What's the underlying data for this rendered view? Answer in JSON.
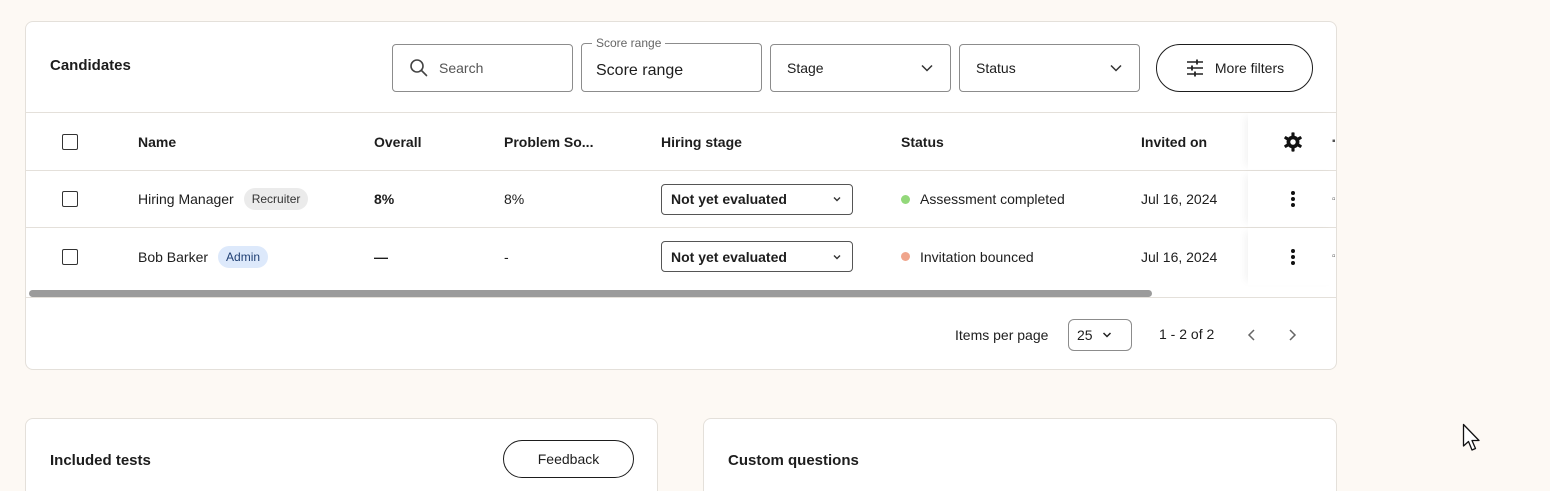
{
  "toolbar": {
    "title": "Candidates",
    "search_placeholder": "Search",
    "score_range_label": "Score range",
    "score_range_value": "Score range",
    "stage_label": "Stage",
    "status_label": "Status",
    "more_filters_label": "More filters"
  },
  "table": {
    "headers": {
      "name": "Name",
      "overall": "Overall",
      "problem": "Problem So...",
      "hiring_stage": "Hiring stage",
      "status": "Status",
      "invited_on": "Invited on"
    },
    "rows": [
      {
        "name": "Hiring Manager",
        "role": "Recruiter",
        "overall": "8%",
        "problem": "8%",
        "hiring_stage": "Not yet evaluated",
        "status": "Assessment completed",
        "status_color": "#93d87a",
        "invited_on": "Jul 16, 2024"
      },
      {
        "name": "Bob Barker",
        "role": "Admin",
        "overall": "—",
        "problem": "-",
        "hiring_stage": "Not yet evaluated",
        "status": "Invitation bounced",
        "status_color": "#f0a58c",
        "invited_on": "Jul 16, 2024"
      }
    ]
  },
  "pagination": {
    "items_per_page_label": "Items per page",
    "items_per_page_value": "25",
    "range_text": "1 - 2 of 2"
  },
  "included_tests": {
    "title": "Included tests",
    "feedback_label": "Feedback"
  },
  "custom_questions": {
    "title": "Custom questions"
  },
  "icons": {
    "search": "search-icon",
    "chevron": "chevron-down-icon",
    "filters": "sliders-icon",
    "settings": "gear-icon",
    "row_menu": "more-vertical-icon",
    "prev": "chevron-left-icon",
    "next": "chevron-right-icon"
  }
}
